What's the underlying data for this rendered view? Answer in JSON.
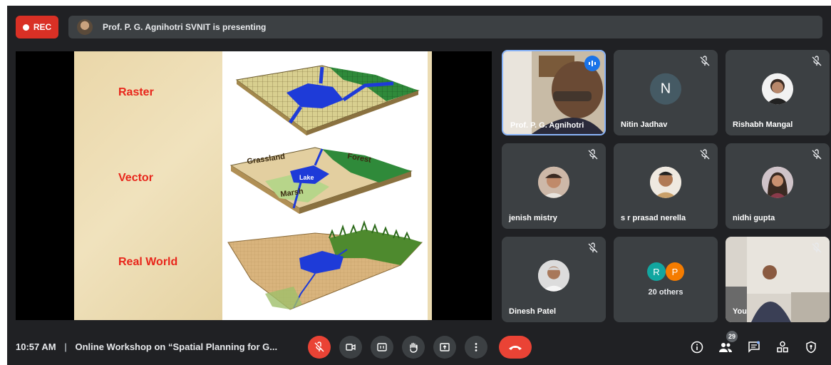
{
  "top": {
    "rec_label": "REC",
    "presenting_text": "Prof. P. G. Agnihotri SVNIT is presenting"
  },
  "slide": {
    "labels": [
      "Raster",
      "Vector",
      "Real World"
    ],
    "map_labels": [
      "Grassland",
      "Forest",
      "Lake",
      "Marsh"
    ]
  },
  "participants": [
    {
      "name": "Prof. P. G. Agnihotri",
      "speaking": true
    },
    {
      "name": "Nitin Jadhav",
      "initial": "N",
      "muted": true
    },
    {
      "name": "Rishabh Mangal",
      "muted": true
    },
    {
      "name": "jenish mistry",
      "muted": true
    },
    {
      "name": "s r prasad nerella",
      "muted": true
    },
    {
      "name": "nidhi gupta",
      "muted": true
    },
    {
      "name": "Dinesh Patel",
      "muted": true
    },
    {
      "name": "20 others",
      "initials": [
        "R",
        "P"
      ]
    },
    {
      "name": "You",
      "muted": true
    }
  ],
  "bottom": {
    "time": "10:57 AM",
    "separator": "|",
    "meeting_title": "Online Workshop on “Spatial Planning for G...",
    "participant_count": "29"
  },
  "colors": {
    "background": "#202124",
    "tile": "#3c4043",
    "danger": "#ea4335",
    "speaking_ring": "#8ab4f8",
    "avatar_R": "#12a6a0",
    "avatar_P": "#f57c00"
  }
}
